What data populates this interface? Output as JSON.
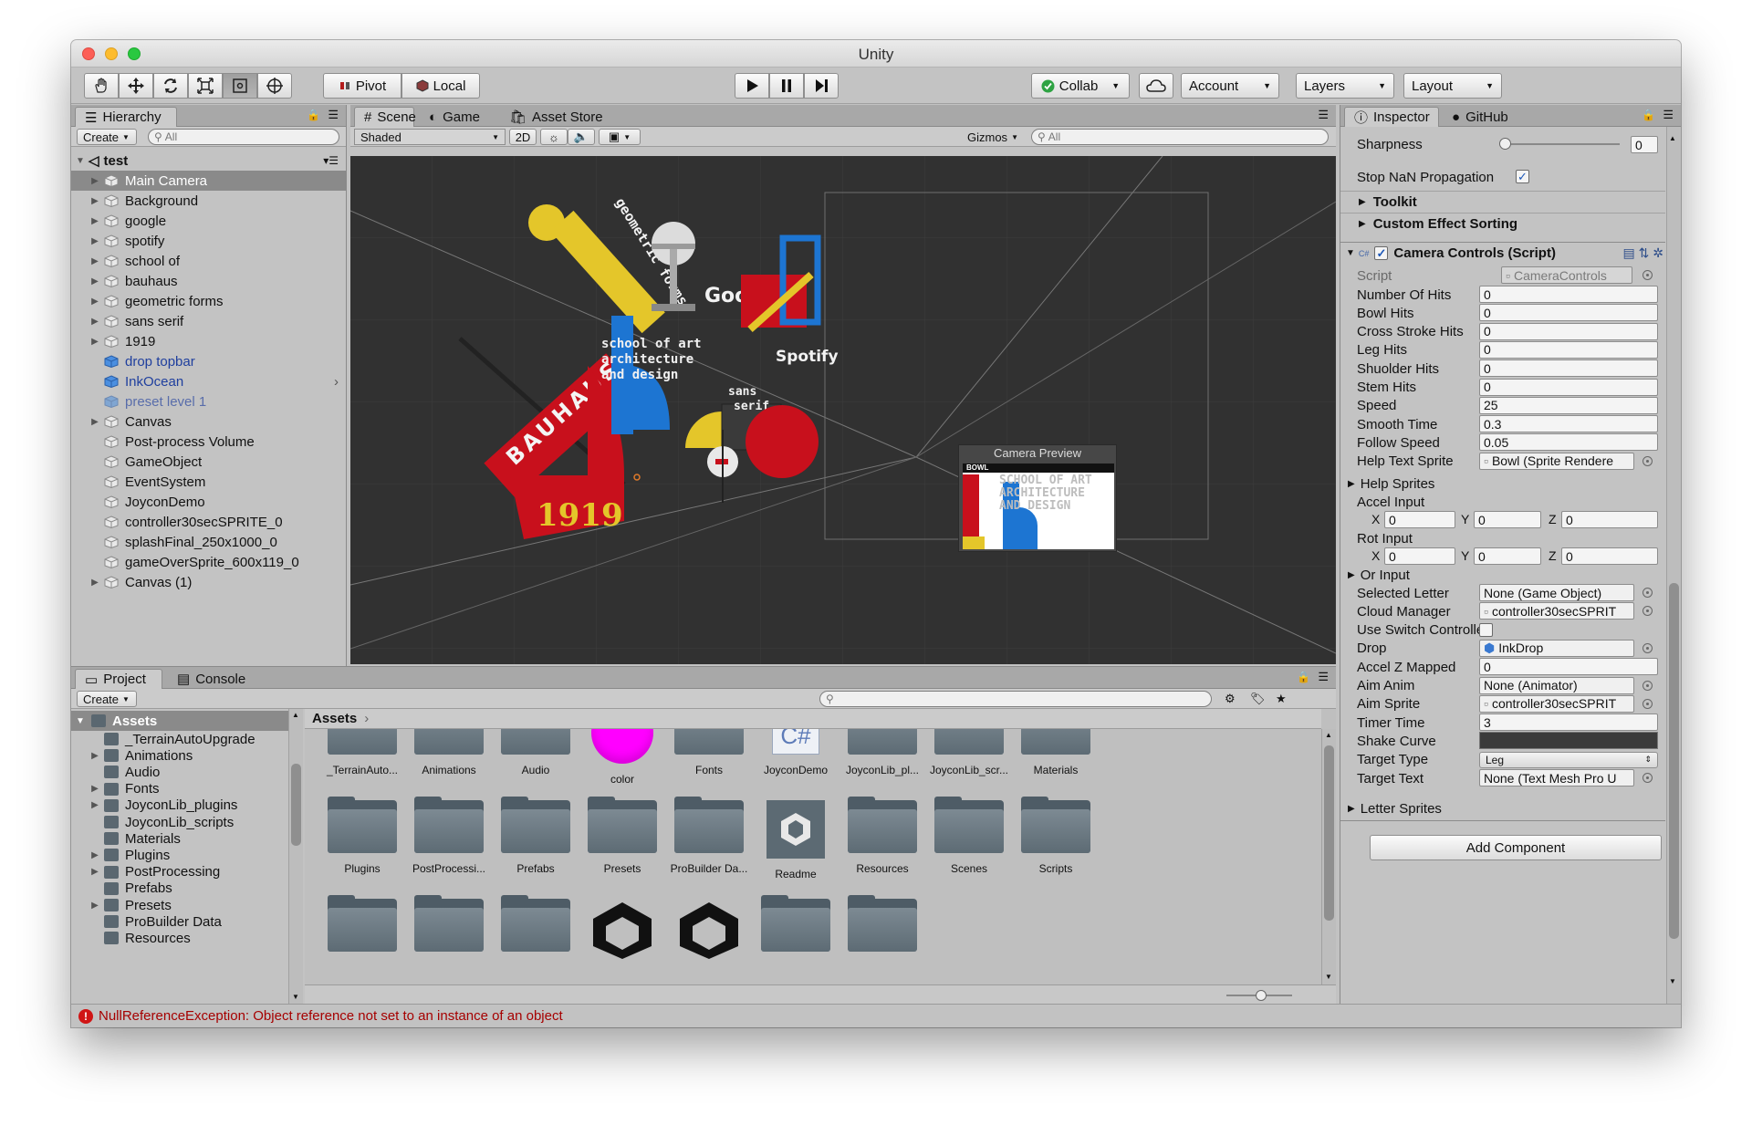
{
  "window": {
    "title": "Unity"
  },
  "toolbar": {
    "pivot": "Pivot",
    "local": "Local",
    "collab": "Collab",
    "account": "Account",
    "layers": "Layers",
    "layout": "Layout"
  },
  "hierarchy": {
    "tab": "Hierarchy",
    "create": "Create",
    "search_placeholder": "All",
    "scene_name": "test",
    "items": [
      {
        "label": "Main Camera",
        "expand": true,
        "selected": true,
        "prefab": false
      },
      {
        "label": "Background",
        "expand": true,
        "selected": false,
        "prefab": false
      },
      {
        "label": "google",
        "expand": true,
        "selected": false,
        "prefab": false
      },
      {
        "label": "spotify",
        "expand": true,
        "selected": false,
        "prefab": false
      },
      {
        "label": "school of",
        "expand": true,
        "selected": false,
        "prefab": false
      },
      {
        "label": "bauhaus",
        "expand": true,
        "selected": false,
        "prefab": false
      },
      {
        "label": "geometric forms",
        "expand": true,
        "selected": false,
        "prefab": false
      },
      {
        "label": "sans serif",
        "expand": true,
        "selected": false,
        "prefab": false
      },
      {
        "label": "1919",
        "expand": true,
        "selected": false,
        "prefab": false
      },
      {
        "label": "drop topbar",
        "expand": false,
        "selected": false,
        "prefab": true
      },
      {
        "label": "InkOcean",
        "expand": false,
        "selected": false,
        "prefab": true
      },
      {
        "label": "preset level 1",
        "expand": false,
        "selected": false,
        "prefab": true,
        "faded": true
      },
      {
        "label": "Canvas",
        "expand": true,
        "selected": false,
        "prefab": false
      },
      {
        "label": "Post-process Volume",
        "expand": false,
        "selected": false,
        "prefab": false
      },
      {
        "label": "GameObject",
        "expand": false,
        "selected": false,
        "prefab": false
      },
      {
        "label": "EventSystem",
        "expand": false,
        "selected": false,
        "prefab": false
      },
      {
        "label": "JoyconDemo",
        "expand": false,
        "selected": false,
        "prefab": false
      },
      {
        "label": "controller30secSPRITE_0",
        "expand": false,
        "selected": false,
        "prefab": false
      },
      {
        "label": "splashFinal_250x1000_0",
        "expand": false,
        "selected": false,
        "prefab": false
      },
      {
        "label": "gameOverSprite_600x119_0",
        "expand": false,
        "selected": false,
        "prefab": false
      },
      {
        "label": "Canvas (1)",
        "expand": true,
        "selected": false,
        "prefab": false
      }
    ]
  },
  "scene": {
    "tabs": [
      "Scene",
      "Game",
      "Asset Store"
    ],
    "shading": "Shaded",
    "mode_2d": "2D",
    "gizmos": "Gizmos",
    "search_placeholder": "All",
    "camera_preview_label": "Camera Preview",
    "preview_bowl": "BOWL",
    "preview_text": [
      "SCHOOL OF ART",
      "ARCHITECTURE",
      "AND DESIGN"
    ],
    "art": {
      "geometric": "geometric forms",
      "bauhaus": "BAUHAUS",
      "year": "1919",
      "google": "Google",
      "spotify": "Spotify",
      "school": [
        "school of art",
        "architecture",
        "and design"
      ],
      "sans": [
        "sans",
        "serif"
      ]
    }
  },
  "inspector": {
    "tabs": [
      "Inspector",
      "GitHub"
    ],
    "sharpness": {
      "label": "Sharpness",
      "value": "0",
      "slider_fraction": 0.0
    },
    "stop_nan": {
      "label": "Stop NaN Propagation",
      "checked": true
    },
    "toolkit": "Toolkit",
    "custom_sorting": "Custom Effect Sorting",
    "component_title": "Camera Controls (Script)",
    "script": {
      "label": "Script",
      "value": "CameraControls"
    },
    "fields": [
      {
        "label": "Number Of Hits",
        "value": "0",
        "kind": "text"
      },
      {
        "label": "Bowl Hits",
        "value": "0",
        "kind": "text"
      },
      {
        "label": "Cross Stroke Hits",
        "value": "0",
        "kind": "text"
      },
      {
        "label": "Leg Hits",
        "value": "0",
        "kind": "text"
      },
      {
        "label": "Shuolder Hits",
        "value": "0",
        "kind": "text"
      },
      {
        "label": "Stem Hits",
        "value": "0",
        "kind": "text"
      },
      {
        "label": "Speed",
        "value": "25",
        "kind": "text"
      },
      {
        "label": "Smooth Time",
        "value": "0.3",
        "kind": "text"
      },
      {
        "label": "Follow Speed",
        "value": "0.05",
        "kind": "text"
      },
      {
        "label": "Help Text Sprite",
        "value": "Bowl (Sprite Rendere",
        "kind": "object"
      }
    ],
    "help_sprites": "Help Sprites",
    "accel_input": {
      "label": "Accel Input",
      "x": "0",
      "y": "0",
      "z": "0"
    },
    "rot_input": {
      "label": "Rot Input",
      "x": "0",
      "y": "0",
      "z": "0"
    },
    "axis_labels": {
      "x": "X",
      "y": "Y",
      "z": "Z"
    },
    "or_input": "Or Input",
    "fields2": [
      {
        "label": "Selected Letter",
        "value": "None (Game Object)",
        "kind": "object"
      },
      {
        "label": "Cloud Manager",
        "value": "controller30secSPRIT",
        "kind": "object"
      },
      {
        "label": "Use Switch Controller",
        "value": "",
        "kind": "checkbox"
      },
      {
        "label": "Drop",
        "value": "InkDrop",
        "kind": "object"
      },
      {
        "label": "Accel Z Mapped",
        "value": "0",
        "kind": "text"
      },
      {
        "label": "Aim Anim",
        "value": "None (Animator)",
        "kind": "object"
      },
      {
        "label": "Aim Sprite",
        "value": "controller30secSPRIT",
        "kind": "object"
      },
      {
        "label": "Timer Time",
        "value": "3",
        "kind": "text"
      },
      {
        "label": "Shake Curve",
        "value": "",
        "kind": "curve"
      },
      {
        "label": "Target Type",
        "value": "Leg",
        "kind": "dropdown"
      },
      {
        "label": "Target Text",
        "value": "None (Text Mesh Pro U",
        "kind": "object"
      }
    ],
    "letter_sprites": "Letter Sprites",
    "add_component": "Add Component"
  },
  "project": {
    "tabs": [
      "Project",
      "Console"
    ],
    "create": "Create",
    "tree_root": "Assets",
    "tree": [
      {
        "label": "_TerrainAutoUpgrade",
        "expand": false
      },
      {
        "label": "Animations",
        "expand": true
      },
      {
        "label": "Audio",
        "expand": false
      },
      {
        "label": "Fonts",
        "expand": true
      },
      {
        "label": "JoyconLib_plugins",
        "expand": true
      },
      {
        "label": "JoyconLib_scripts",
        "expand": false
      },
      {
        "label": "Materials",
        "expand": false
      },
      {
        "label": "Plugins",
        "expand": true
      },
      {
        "label": "PostProcessing",
        "expand": true
      },
      {
        "label": "Prefabs",
        "expand": false
      },
      {
        "label": "Presets",
        "expand": true
      },
      {
        "label": "ProBuilder Data",
        "expand": false
      },
      {
        "label": "Resources",
        "expand": false
      }
    ],
    "breadcrumb": "Assets",
    "row1": [
      {
        "label": "_TerrainAuto...",
        "kind": "folder"
      },
      {
        "label": "Animations",
        "kind": "folder"
      },
      {
        "label": "Audio",
        "kind": "folder"
      },
      {
        "label": "color",
        "kind": "color"
      },
      {
        "label": "Fonts",
        "kind": "folder"
      },
      {
        "label": "JoyconDemo",
        "kind": "csharp"
      },
      {
        "label": "JoyconLib_pl...",
        "kind": "folder"
      },
      {
        "label": "JoyconLib_scr...",
        "kind": "folder"
      },
      {
        "label": "Materials",
        "kind": "folder"
      }
    ],
    "row2": [
      {
        "label": "Plugins",
        "kind": "folder"
      },
      {
        "label": "PostProcessi...",
        "kind": "folder"
      },
      {
        "label": "Prefabs",
        "kind": "folder"
      },
      {
        "label": "Presets",
        "kind": "folder"
      },
      {
        "label": "ProBuilder Da...",
        "kind": "folder"
      },
      {
        "label": "Readme",
        "kind": "unity"
      },
      {
        "label": "Resources",
        "kind": "folder"
      },
      {
        "label": "Scenes",
        "kind": "folder"
      },
      {
        "label": "Scripts",
        "kind": "folder"
      }
    ],
    "row3": [
      {
        "label": "",
        "kind": "folder"
      },
      {
        "label": "",
        "kind": "folder"
      },
      {
        "label": "",
        "kind": "folder"
      },
      {
        "label": "",
        "kind": "unitylogo"
      },
      {
        "label": "",
        "kind": "unitylogo"
      },
      {
        "label": "",
        "kind": "folder"
      },
      {
        "label": "",
        "kind": "folder"
      }
    ],
    "csharp_label": "C#"
  },
  "status": {
    "message": "NullReferenceException: Object reference not set to an instance of an object",
    "error_mark": "!"
  },
  "colors": {
    "selection": "#8a8a8a",
    "prefab_text": "#1f3f9e",
    "bauhaus_red": "#c8101c",
    "bauhaus_yellow": "#e4c62a",
    "bauhaus_blue": "#1d75d2",
    "magenta": "#ff00ff",
    "error": "#a60000"
  }
}
